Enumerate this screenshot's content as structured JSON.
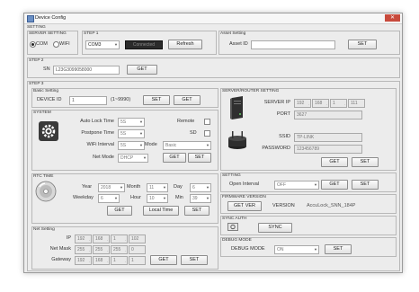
{
  "window": {
    "title": "Device Config"
  },
  "setting": {
    "group_label": "SETTING",
    "server_setting": {
      "label": "SERVER SETTING",
      "com_label": "COM",
      "wifi_label": "WIFI"
    },
    "step1": {
      "label": "STEP 1",
      "port": "COM3",
      "status": "Connected",
      "refresh_label": "Refresh"
    },
    "asset": {
      "group_label": "Asset Setting",
      "label": "Asset ID",
      "value": "",
      "set_label": "SET"
    }
  },
  "step2": {
    "label": "STEP 2",
    "sn_label": "SN",
    "sn_value": "L23G3099058000",
    "get_label": "GET"
  },
  "step3": {
    "label": "STEP 3"
  },
  "basic": {
    "label": "Basic Setting",
    "device_id_label": "DEVICE ID",
    "device_id_value": "1",
    "range": "(1~9990)",
    "set_label": "SET",
    "get_label": "GET"
  },
  "system": {
    "label": "SYSTEM",
    "auto_lock_label": "Auto Lock Time",
    "auto_lock_value": "5S",
    "remote_label": "Remote",
    "postpone_label": "Postpone Time",
    "postpone_value": "5S",
    "sd_label": "SD",
    "wifi_interval_label": "WiFi Interval",
    "wifi_interval_value": "5S",
    "mode_label": "Mode",
    "mode_value": "Basic",
    "net_mode_label": "Net Mode",
    "net_mode_value": "DHCP",
    "get_label": "GET",
    "set_label": "SET"
  },
  "rtc": {
    "label": "RTC TIME",
    "year_label": "Year",
    "year_value": "2018",
    "month_label": "Month",
    "month_value": "11",
    "day_label": "Day",
    "day_value": "6",
    "weekday_label": "Weekday",
    "weekday_value": "6",
    "hour_label": "Hour",
    "hour_value": "10",
    "min_label": "Min",
    "min_value": "39",
    "get_label": "GET",
    "local_time_label": "Local Time",
    "set_label": "SET"
  },
  "net": {
    "label": "Net Setting",
    "ip_label": "IP",
    "ip": [
      "192",
      "168",
      "1",
      "102"
    ],
    "mask_label": "Net Mask",
    "mask": [
      "255",
      "255",
      "255",
      "0"
    ],
    "gateway_label": "Gateway",
    "gateway": [
      "192",
      "168",
      "1",
      "1"
    ],
    "get_label": "GET",
    "set_label": "SET"
  },
  "server_router": {
    "label": "SERVER/ROUTER SETTING",
    "server_ip_label": "SERVER IP",
    "server_ip": [
      "192",
      "168",
      "1",
      "111"
    ],
    "port_label": "PORT",
    "port_value": "3627",
    "ssid_label": "SSID",
    "ssid_value": "TP-LINK",
    "password_label": "PASSWORD",
    "password_value": "123456789",
    "get_label": "GET",
    "set_label": "SET"
  },
  "settings": {
    "label": "SETTING",
    "open_interval_label": "Open Interval",
    "open_interval_value": "OFF",
    "get_label": "GET",
    "set_label": "SET"
  },
  "firmware": {
    "label": "FIRMWARE VERSION",
    "get_ver_label": "GET VER",
    "version_label": "VERSION",
    "version_value": "AccuLock_SNN_184P"
  },
  "sync": {
    "label": "SYNC AUTH",
    "sync_label": "SYNC"
  },
  "debug": {
    "label": "DEBUG MODE",
    "mode_label": "DEBUG MODE",
    "mode_value": "ON",
    "set_label": "SET"
  },
  "colors": {
    "status_bg": "#2b2b2b",
    "status_text": "#8a8a8a",
    "close": "#c84a3c"
  }
}
